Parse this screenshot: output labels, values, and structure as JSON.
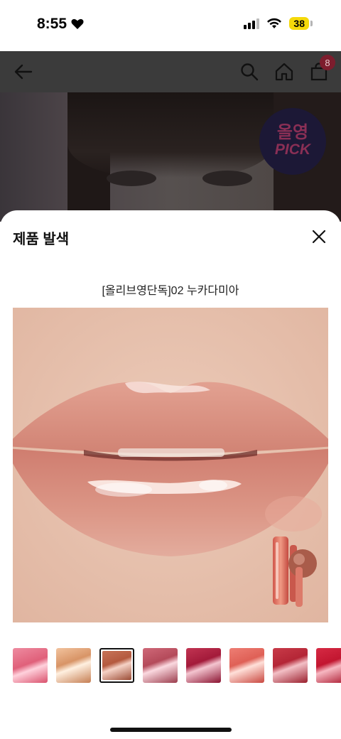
{
  "status_bar": {
    "time": "8:55",
    "battery": "38"
  },
  "nav": {
    "cart_count": "8"
  },
  "background": {
    "badge_line1": "올영",
    "badge_line2": "PICK"
  },
  "sheet": {
    "title": "제품 발색",
    "product_name": "[올리브영단독]02 누카다미아"
  },
  "swatches": [
    {
      "color": "#e0607a",
      "selected": false
    },
    {
      "color": "#d89466",
      "selected": false
    },
    {
      "color": "#b4593e",
      "selected": true
    },
    {
      "color": "#b44a5a",
      "selected": false
    },
    {
      "color": "#a31a3a",
      "selected": false
    },
    {
      "color": "#df6056",
      "selected": false
    },
    {
      "color": "#b42636",
      "selected": false
    },
    {
      "color": "#c21630",
      "selected": false
    }
  ],
  "colors": {
    "sheet_bg": "#ffffff",
    "overlay": "#3b3b3b",
    "badge_bg": "#1c1836",
    "badge_text": "#8a2f55",
    "cart_badge": "#7d1d2d"
  }
}
